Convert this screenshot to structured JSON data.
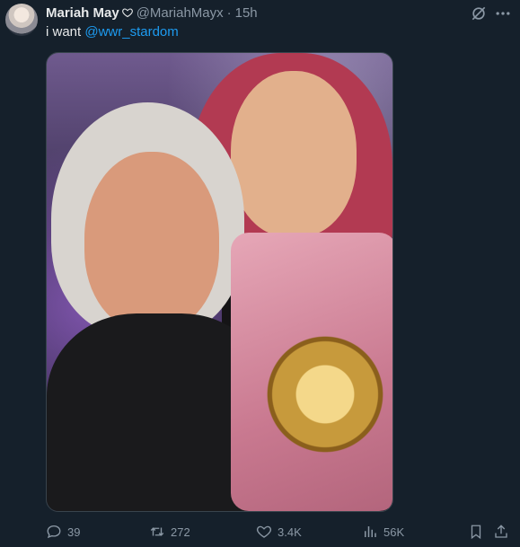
{
  "tweet": {
    "author_name": "Mariah May",
    "handle": "@MariahMayx",
    "separator": "·",
    "time": "15h",
    "text_prefix": "i want ",
    "mention": "@wwr_stardom"
  },
  "actions": {
    "replies": "39",
    "retweets": "272",
    "likes": "3.4K",
    "views": "56K"
  },
  "colors": {
    "background": "#15202b",
    "accent": "#1d9bf0",
    "muted_text": "#8b98a5"
  }
}
